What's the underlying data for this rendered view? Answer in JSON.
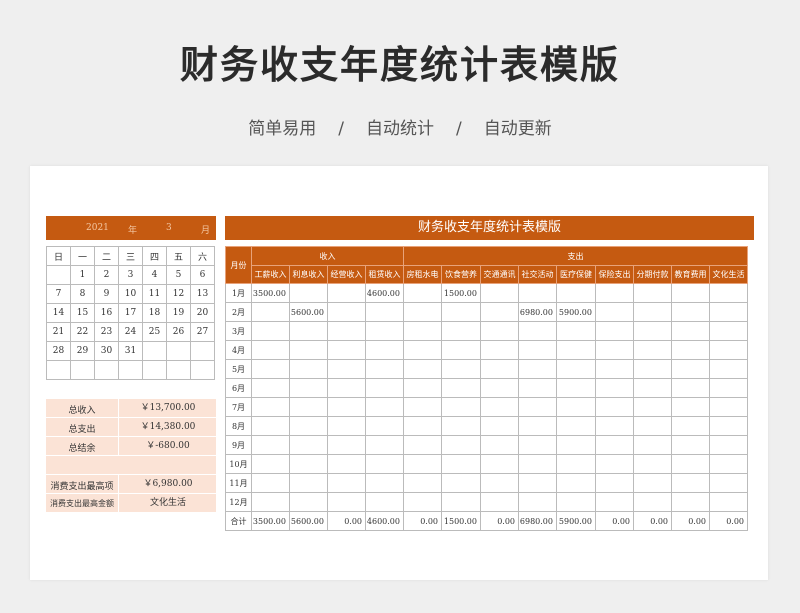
{
  "title": "财务收支年度统计表模版",
  "subtitle": [
    "简单易用",
    "自动统计",
    "自动更新"
  ],
  "subtitle_sep": "/",
  "calendar": {
    "year": "2021",
    "year_label": "年",
    "month": "3",
    "month_label": "月",
    "weekdays": [
      "日",
      "一",
      "二",
      "三",
      "四",
      "五",
      "六"
    ],
    "weeks": [
      [
        "",
        "1",
        "2",
        "3",
        "4",
        "5",
        "6"
      ],
      [
        "7",
        "8",
        "9",
        "10",
        "11",
        "12",
        "13"
      ],
      [
        "14",
        "15",
        "16",
        "17",
        "18",
        "19",
        "20"
      ],
      [
        "21",
        "22",
        "23",
        "24",
        "25",
        "26",
        "27"
      ],
      [
        "28",
        "29",
        "30",
        "31",
        "",
        "",
        ""
      ],
      [
        "",
        "",
        "",
        "",
        "",
        "",
        ""
      ]
    ]
  },
  "summary": {
    "total_income_label": "总收入",
    "total_income": "￥13,700.00",
    "total_expense_label": "总支出",
    "total_expense": "￥14,380.00",
    "balance_label": "总结余",
    "balance": "￥-680.00",
    "max_expense_label": "消费支出最高项",
    "max_expense": "￥6,980.00",
    "max_expense_item_label": "消费支出最高金额",
    "max_expense_item": "文化生活"
  },
  "table": {
    "title": "财务收支年度统计表模版",
    "month_header": "月份",
    "income_header": "收入",
    "expense_header": "支出",
    "columns": [
      "工薪收入",
      "利息收入",
      "经营收入",
      "租赁收入",
      "房租水电",
      "饮食营养",
      "交通通讯",
      "社交活动",
      "医疗保健",
      "保险支出",
      "分期付款",
      "教育费用",
      "文化生活"
    ],
    "rows": [
      {
        "month": "1月",
        "values": [
          "3500.00",
          "",
          "",
          "4600.00",
          "",
          "1500.00",
          "",
          "",
          "",
          "",
          "",
          "",
          ""
        ]
      },
      {
        "month": "2月",
        "values": [
          "",
          "5600.00",
          "",
          "",
          "",
          "",
          "",
          "6980.00",
          "5900.00",
          "",
          "",
          "",
          ""
        ]
      },
      {
        "month": "3月",
        "values": [
          "",
          "",
          "",
          "",
          "",
          "",
          "",
          "",
          "",
          "",
          "",
          "",
          ""
        ]
      },
      {
        "month": "4月",
        "values": [
          "",
          "",
          "",
          "",
          "",
          "",
          "",
          "",
          "",
          "",
          "",
          "",
          ""
        ]
      },
      {
        "month": "5月",
        "values": [
          "",
          "",
          "",
          "",
          "",
          "",
          "",
          "",
          "",
          "",
          "",
          "",
          ""
        ]
      },
      {
        "month": "6月",
        "values": [
          "",
          "",
          "",
          "",
          "",
          "",
          "",
          "",
          "",
          "",
          "",
          "",
          ""
        ]
      },
      {
        "month": "7月",
        "values": [
          "",
          "",
          "",
          "",
          "",
          "",
          "",
          "",
          "",
          "",
          "",
          "",
          ""
        ]
      },
      {
        "month": "8月",
        "values": [
          "",
          "",
          "",
          "",
          "",
          "",
          "",
          "",
          "",
          "",
          "",
          "",
          ""
        ]
      },
      {
        "month": "9月",
        "values": [
          "",
          "",
          "",
          "",
          "",
          "",
          "",
          "",
          "",
          "",
          "",
          "",
          ""
        ]
      },
      {
        "month": "10月",
        "values": [
          "",
          "",
          "",
          "",
          "",
          "",
          "",
          "",
          "",
          "",
          "",
          "",
          ""
        ]
      },
      {
        "month": "11月",
        "values": [
          "",
          "",
          "",
          "",
          "",
          "",
          "",
          "",
          "",
          "",
          "",
          "",
          ""
        ]
      },
      {
        "month": "12月",
        "values": [
          "",
          "",
          "",
          "",
          "",
          "",
          "",
          "",
          "",
          "",
          "",
          "",
          ""
        ]
      }
    ],
    "total": {
      "month": "合计",
      "values": [
        "3500.00",
        "5600.00",
        "0.00",
        "4600.00",
        "0.00",
        "1500.00",
        "0.00",
        "6980.00",
        "5900.00",
        "0.00",
        "0.00",
        "0.00",
        "0.00"
      ]
    }
  },
  "colors": {
    "accent": "#c55a11",
    "summary_bg": "#fbe3d6"
  }
}
